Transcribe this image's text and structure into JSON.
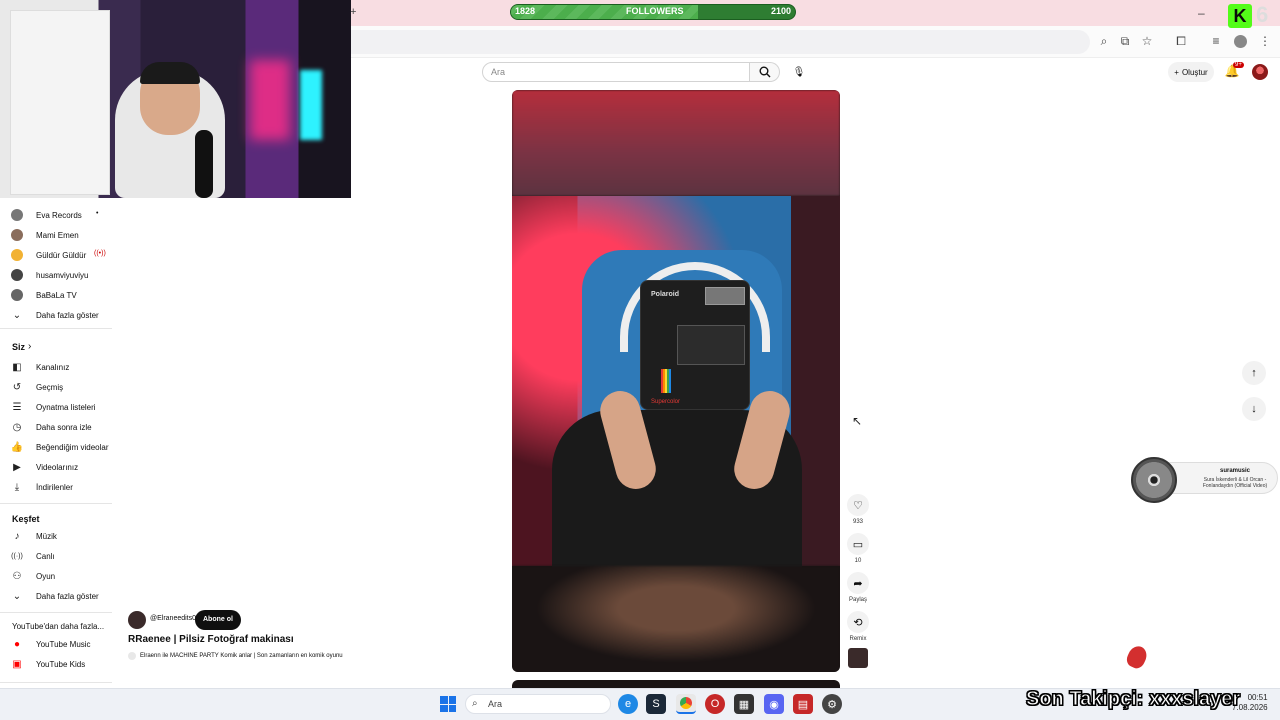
{
  "followers_bar": {
    "label": "FOLLOWERS",
    "current": "1828",
    "goal": "2100",
    "progress": 0.66
  },
  "kick_counter": "6",
  "search": {
    "placeholder": "Ara"
  },
  "header": {
    "create_label": "Oluştur",
    "notification_badge": "9+"
  },
  "sidebar": {
    "subscriptions": [
      {
        "label": "Eva Records",
        "marker": "•",
        "color": "#777777"
      },
      {
        "label": "Mami Emen",
        "color": "#8a6d5c"
      },
      {
        "label": "Güldür Güldür",
        "marker": "((•))",
        "color": "#f2b233"
      },
      {
        "label": "husamviyuviyu",
        "color": "#444444"
      },
      {
        "label": "BaBaLa TV",
        "color": "#666666"
      },
      {
        "label": "Daha fazla göster"
      }
    ],
    "you_heading": "Siz",
    "you_items": [
      {
        "label": "Kanalınız",
        "icon": "channel-icon"
      },
      {
        "label": "Geçmiş",
        "icon": "history-icon"
      },
      {
        "label": "Oynatma listeleri",
        "icon": "playlist-icon"
      },
      {
        "label": "Daha sonra izle",
        "icon": "clock-icon"
      },
      {
        "label": "Beğendiğim videolar",
        "icon": "thumbs-up-icon"
      },
      {
        "label": "Videolarınız",
        "icon": "video-icon"
      },
      {
        "label": "İndirilenler",
        "icon": "download-icon"
      }
    ],
    "explore_heading": "Keşfet",
    "explore_items": [
      {
        "label": "Müzik",
        "icon": "music-icon"
      },
      {
        "label": "Canlı",
        "icon": "live-icon"
      },
      {
        "label": "Oyun",
        "icon": "gamepad-icon"
      },
      {
        "label": "Daha fazla göster",
        "icon": "chevron-down-icon"
      }
    ],
    "more_heading": "YouTube'dan daha fazla...",
    "more_items": [
      {
        "label": "YouTube Music",
        "icon": "youtube-music-icon"
      },
      {
        "label": "YouTube Kids",
        "icon": "youtube-kids-icon"
      }
    ]
  },
  "short": {
    "camera_brand": "Polaroid",
    "camera_model": "Supercolor",
    "likes": "933",
    "comments": "10",
    "share_label": "Paylaş",
    "remix_label": "Remix",
    "channel": "@Elraneedits0",
    "subscribe_label": "Abone ol",
    "title": "RRaenee | Pilsiz Fotoğraf makinası",
    "song": "Elraenn ile MACHINE PARTY Komik anlar | Son zamanların en komik oyunu"
  },
  "music_widget": {
    "artist": "suramusic",
    "song": "Sura İskenderli & Lil Orcan - Fonlandaydın (Official Video)"
  },
  "taskbar": {
    "search_placeholder": "Ara",
    "time": "00:51",
    "date": "7.08.2026"
  },
  "overlay": {
    "last_follower": "Son Takipçi: xxxslayer"
  },
  "colors": {
    "accent": "#cc0000",
    "followers_green": "#2e7d32",
    "kick_green": "#53fc18"
  }
}
